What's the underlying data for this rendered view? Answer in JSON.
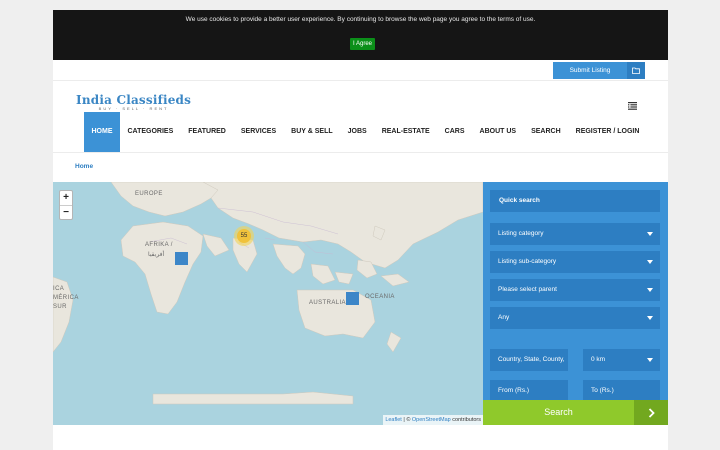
{
  "cookie": {
    "message": "We use cookies to provide a better user experience. By continuing to browse the web page you agree to the terms of use.",
    "agree_label": "I Agree"
  },
  "topbar": {
    "submit_label": "Submit Listing"
  },
  "logo": {
    "title": "India Classifieds",
    "tagline": "BUY · SELL · RENT"
  },
  "nav": {
    "items": [
      "HOME",
      "CATEGORIES",
      "FEATURED",
      "SERVICES",
      "BUY & SELL",
      "JOBS",
      "REAL-ESTATE",
      "CARS",
      "ABOUT US",
      "SEARCH",
      "REGISTER / LOGIN"
    ],
    "active": "HOME"
  },
  "breadcrumb": {
    "home": "Home"
  },
  "map": {
    "zoom_in": "+",
    "zoom_out": "−",
    "labels": {
      "europe": "EUROPE",
      "africa": "AFRIKA /",
      "africa_ar": "أفريقيا",
      "south_america_1": "ICA",
      "south_america_2": "MÉRICA",
      "south_america_3": "SUR",
      "australia": "AUSTRALIA",
      "oceania": "OCEANIA"
    },
    "cluster_count": "55",
    "attribution": {
      "leaflet": "Leaflet",
      "sep": " | © ",
      "osm": "OpenStreetMap",
      "suffix": " contributors"
    }
  },
  "quick_search": {
    "title": "Quick search",
    "listing_category": "Listing category",
    "listing_subcategory": "Listing sub-category",
    "parent": "Please select parent",
    "any": "Any",
    "location_placeholder": "Country, State, County,",
    "radius": "0 km",
    "price_from": "From (Rs.)",
    "price_to": "To (Rs.)",
    "search_label": "Search"
  },
  "colors": {
    "accent": "#3c92d6",
    "accent_dark": "#2d7ec2",
    "search": "#8fc92b",
    "cookie_bar": "#151515",
    "agree": "#0b8f19"
  }
}
